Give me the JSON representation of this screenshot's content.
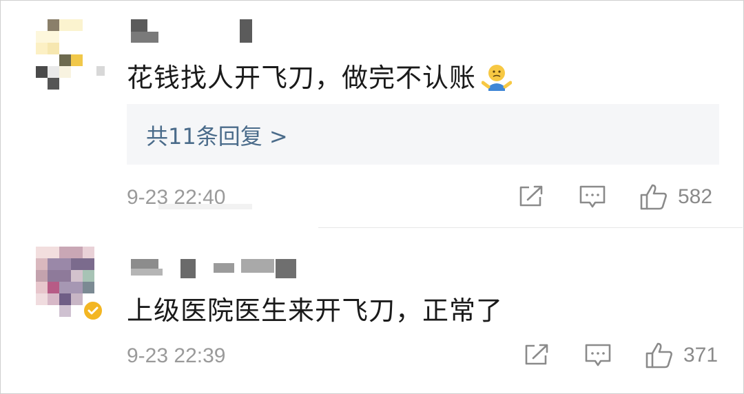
{
  "comments": [
    {
      "text": "花钱找人开飞刀，做完不认账",
      "emoji": "shrug-emoji",
      "replies_label": "共11条回复 >",
      "timestamp": "9-23 22:40",
      "likes": "582"
    },
    {
      "text": "上级医院医生来开飞刀，正常了",
      "timestamp": "9-23 22:39",
      "likes": "371",
      "verified": "verified-badge-icon"
    }
  ],
  "icons": {
    "share": "share-icon",
    "reply": "comment-icon",
    "like": "thumbs-up-icon"
  },
  "colors": {
    "link": "#4a6b8a",
    "meta": "#9a9a9a",
    "badge": "#f3b623",
    "reply_bg": "#f5f6f8"
  }
}
